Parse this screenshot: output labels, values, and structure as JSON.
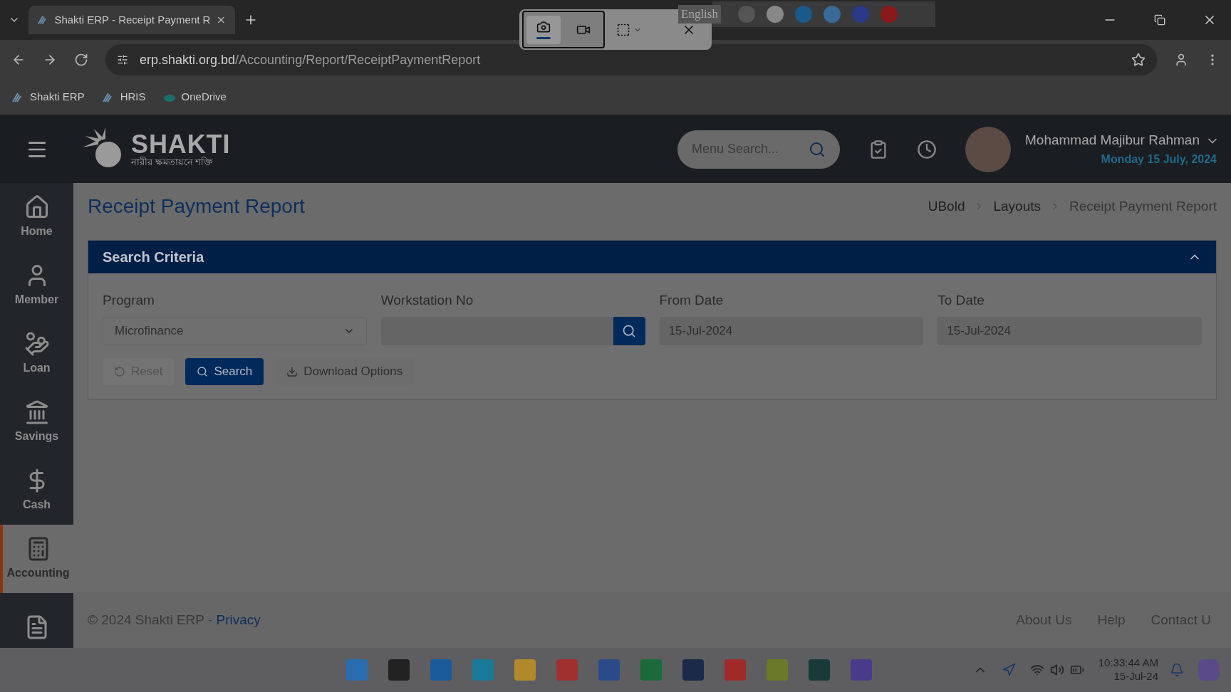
{
  "browser": {
    "tabs": [
      {
        "title": "Shakti ERP - Receipt Payment R",
        "selected": true
      }
    ],
    "url_host": "erp.shakti.org.bd",
    "url_path": "/Accounting/Report/ReceiptPaymentReport",
    "bookmarks": [
      "Shakti ERP",
      "HRIS",
      "OneDrive"
    ]
  },
  "capture_toolbar": {
    "language": "English",
    "modes": [
      {
        "kind": "photo",
        "selected": true
      },
      {
        "kind": "video",
        "selected": false
      }
    ]
  },
  "header": {
    "brand": "SHAKTI",
    "tagline": "নারীর ক্ষমতায়নে শক্তি",
    "search_placeholder": "Menu Search...",
    "user_name": "Mohammad Majibur Rahman",
    "date": "Monday 15 July, 2024"
  },
  "sidebar": {
    "items": [
      {
        "kind": "home",
        "label": "Home",
        "selected": false
      },
      {
        "kind": "member",
        "label": "Member",
        "selected": false
      },
      {
        "kind": "loan",
        "label": "Loan",
        "selected": false
      },
      {
        "kind": "savings",
        "label": "Savings",
        "selected": false
      },
      {
        "kind": "cash",
        "label": "Cash",
        "selected": false
      },
      {
        "kind": "accounting",
        "label": "Accounting",
        "selected": true
      },
      {
        "kind": "report",
        "selected": false
      }
    ]
  },
  "page": {
    "title": "Receipt Payment Report",
    "breadcrumb": [
      "UBold",
      "Layouts",
      "Receipt Payment Report"
    ]
  },
  "search_criteria": {
    "title": "Search Criteria",
    "expanded": true,
    "program": {
      "label": "Program",
      "value": "Microfinance"
    },
    "workstation": {
      "label": "Workstation No"
    },
    "from_date": {
      "label": "From Date",
      "value": "15-Jul-2024"
    },
    "to_date": {
      "label": "To Date",
      "value": "15-Jul-2024"
    },
    "buttons": [
      {
        "kind": "reset",
        "label": "Reset",
        "disabled": true
      },
      {
        "kind": "search",
        "label": "Search",
        "disabled": false
      },
      {
        "kind": "download",
        "label": "Download Options",
        "disabled": false
      }
    ]
  },
  "footer": {
    "copyright": "© 2024 Shakti ERP - ",
    "privacy": "Privacy",
    "links": [
      "About Us",
      "Help",
      "Contact U"
    ]
  },
  "taskbar": {
    "time": "10:33:44 AM",
    "date": "15-Jul-24"
  }
}
